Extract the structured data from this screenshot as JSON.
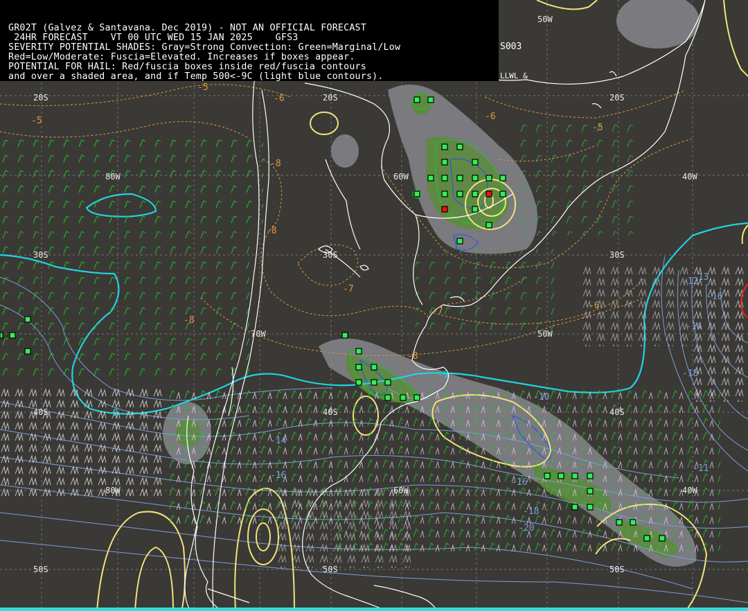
{
  "header": {
    "lines": [
      "GR02T (Galvez & Santavana. Dec 2019) - NOT AN OFFICIAL FORECAST",
      " 24HR FORECAST    VT 00 UTC WED 15 JAN 2025    GFS3",
      "SEVERITY POTENTIAL SHADES: Gray=Strong Convection: Green=Marginal/Low",
      "Red=Low/Moderate: Fuscia=Elevated. Increases if boxes appear.",
      "POTENTIAL FOR HAIL: Red/fuscia boxes inside red/fuscia contours",
      "and over a shaded area, and if Temp 500<-9C (light blue contours)."
    ],
    "right_code": "S003",
    "right_sub": "LLWL &"
  },
  "grid_labels": {
    "lat_20": "20S",
    "lat_30": "30S",
    "lat_40": "40S",
    "lat_50": "50S",
    "lon_80": "80W",
    "lon_70": "70W",
    "lon_60": "60W",
    "lon_50": "50W",
    "lon_40": "40W"
  },
  "contour_values": {
    "t500_cyan": "-9",
    "t500_labels": [
      "-10",
      "-11",
      "-12",
      "-13",
      "-14",
      "-16",
      "-18",
      "-20"
    ],
    "orange_labels": [
      "-5",
      "-6",
      "-7",
      "-8"
    ]
  },
  "colors": {
    "background": "#3b3936",
    "coastline": "#ffffff",
    "grid": "#8a8a8a",
    "cyan_contour": "#22d3e0",
    "blue_contour": "#7d9fd6",
    "orange_contour": "#e09a3c",
    "yellow_contour": "#efe57a",
    "green_barb": "#22c32a",
    "white_barb": "#d8d8d8",
    "shade_gray": "#8a8a90",
    "shade_green": "#5a8c3a",
    "box_green": "#33ee55",
    "box_red": "#ee1111"
  }
}
